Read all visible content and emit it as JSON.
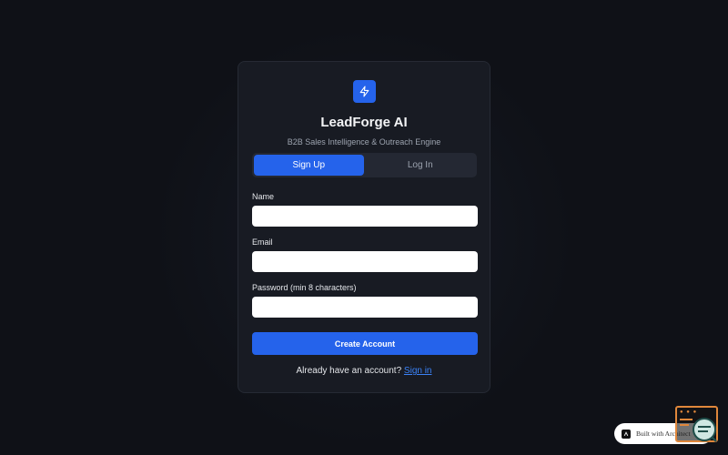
{
  "app": {
    "title": "LeadForge AI",
    "subtitle": "B2B Sales Intelligence & Outreach Engine",
    "accent_color": "#2563eb"
  },
  "tabs": [
    {
      "label": "Sign Up",
      "active": true
    },
    {
      "label": "Log In",
      "active": false
    }
  ],
  "form": {
    "name": {
      "label": "Name",
      "value": ""
    },
    "email": {
      "label": "Email",
      "value": ""
    },
    "password": {
      "label": "Password (min 8 characters)",
      "value": ""
    },
    "submit_label": "Create Account"
  },
  "footer": {
    "prompt": "Already have an account?",
    "link_label": "Sign in"
  },
  "badge": {
    "label": "Built with Architect",
    "icon": "architect-logo-icon"
  },
  "icons": {
    "logo": "lightning-bolt-icon",
    "widget": "chat-support-icon"
  }
}
